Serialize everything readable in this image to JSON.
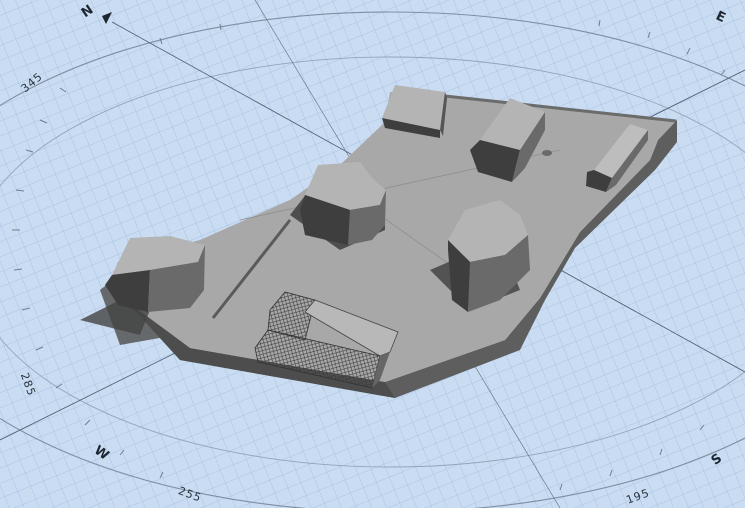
{
  "compass": {
    "north": "N",
    "east": "E",
    "south": "S",
    "west": "W",
    "deg_345": "345",
    "deg_285": "285",
    "deg_255": "255",
    "deg_195": "195"
  },
  "colors": {
    "sky_grid": "#c9dcf2",
    "grid_line": "#a9c2e2",
    "terrain_top": "#a8a8a8",
    "terrain_side": "#5e5e5e",
    "building_top": "#b4b4b4",
    "building_wall": "#6a6a6a",
    "building_dark": "#3e3e3e",
    "shadow": "#4a4a4a"
  },
  "model": {
    "buildings": [
      "building-west",
      "building-center",
      "building-north",
      "building-northeast",
      "building-east-long",
      "building-southeast",
      "greenhouse"
    ]
  }
}
